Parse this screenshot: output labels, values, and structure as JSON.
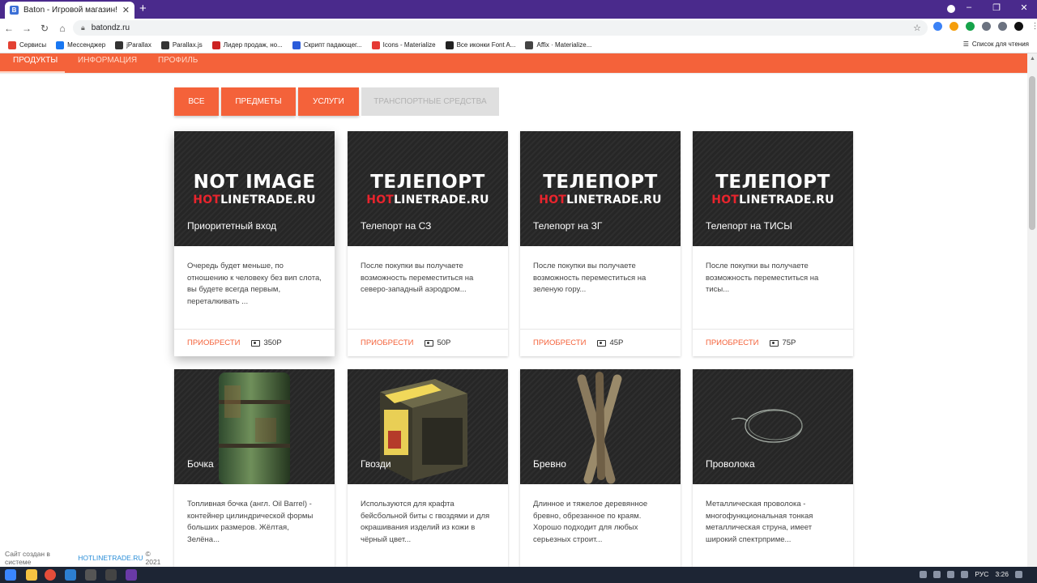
{
  "browser": {
    "tab_title": "Baton - Игровой магазин!",
    "tab_close": "✕",
    "new_tab": "+",
    "url": "batondz.ru",
    "bookmarks": [
      {
        "label": "Сервисы",
        "color": "#e34133"
      },
      {
        "label": "Мессенджер",
        "color": "#1877f2"
      },
      {
        "label": "jParallax",
        "color": "#333333"
      },
      {
        "label": "Parallax.js",
        "color": "#333333"
      },
      {
        "label": "Лидер продаж, но...",
        "color": "#cc2222"
      },
      {
        "label": "Скрипт падающег...",
        "color": "#2b5cd9"
      },
      {
        "label": "Icons - Materialize",
        "color": "#e53935"
      },
      {
        "label": "Все иконки Font A...",
        "color": "#222222"
      },
      {
        "label": "Affix · Materialize...",
        "color": "#444444"
      }
    ],
    "reading_list": "Список для чтения"
  },
  "site_nav": {
    "tabs": [
      {
        "label": "ПРОДУКТЫ",
        "active": true
      },
      {
        "label": "ИНФОРМАЦИЯ",
        "active": false
      },
      {
        "label": "ПРОФИЛЬ",
        "active": false
      }
    ]
  },
  "filters": [
    {
      "label": "ВСЕ",
      "disabled": false
    },
    {
      "label": "ПРЕДМЕТЫ",
      "disabled": false
    },
    {
      "label": "УСЛУГИ",
      "disabled": false
    },
    {
      "label": "ТРАНСПОРТНЫЕ СРЕДСТВА",
      "disabled": true
    }
  ],
  "cards": [
    {
      "big_title": "NOT IMAGE",
      "brand_red": "HOT",
      "brand_white": "LINETRADE.RU",
      "title": "Приоритетный вход",
      "description": "Очередь будет меньше, по отношению к человеку без вип слота, вы будете всегда первым, переталкивать ...",
      "buy": "ПРИОБРЕСТИ",
      "price": "350Р"
    },
    {
      "big_title": "ТЕЛЕПОРТ",
      "brand_red": "HOT",
      "brand_white": "LINETRADE.RU",
      "title": "Телепорт на СЗ",
      "description": "После покупки вы получаете возможность переместиться на северо-западный аэродром...",
      "buy": "ПРИОБРЕСТИ",
      "price": "50Р"
    },
    {
      "big_title": "ТЕЛЕПОРТ",
      "brand_red": "HOT",
      "brand_white": "LINETRADE.RU",
      "title": "Телепорт на ЗГ",
      "description": "После покупки вы получаете возможность переместиться на зеленую гору...",
      "buy": "ПРИОБРЕСТИ",
      "price": "45Р"
    },
    {
      "big_title": "ТЕЛЕПОРТ",
      "brand_red": "HOT",
      "brand_white": "LINETRADE.RU",
      "title": "Телепорт на ТИСЫ",
      "description": "После покупки вы получаете возможность переместиться на тисы...",
      "buy": "ПРИОБРЕСТИ",
      "price": "75Р"
    },
    {
      "title": "Бочка",
      "image": "barrel",
      "description": "Топливная бочка (англ. Oil Barrel) - контейнер цилиндрической формы больших размеров. Жёлтая, Зелёна..."
    },
    {
      "title": "Гвозди",
      "image": "nails-box",
      "description": "Используются для крафта бейсбольной биты с гвоздями и для окрашивания изделий из кожи в чёрный цвет..."
    },
    {
      "title": "Бревно",
      "image": "logs",
      "description": "Длинное и тяжелое деревянное бревно, обрезанное по краям. Хорошо подходит для любых серьезных строит..."
    },
    {
      "title": "Проволока",
      "image": "wire",
      "description": "Металлическая проволока - многофункциональная тонкая металлическая струна, имеет широкий спектрприме..."
    }
  ],
  "footer": {
    "prefix": "Сайт создан в системе",
    "link": "HOTLINETRADE.RU",
    "suffix": "© 2021"
  },
  "taskbar": {
    "lang": "РУС",
    "time": "3:26"
  }
}
